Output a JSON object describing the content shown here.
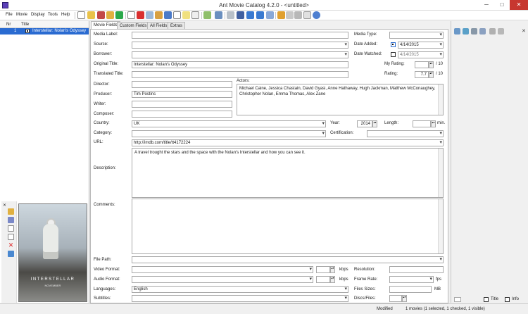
{
  "window": {
    "title": "Ant Movie Catalog 4.2.0 - <untitled>"
  },
  "menu": [
    "File",
    "Movie",
    "Display",
    "Tools",
    "Help"
  ],
  "list": {
    "headers": [
      "Nr",
      "Title"
    ],
    "rows": [
      {
        "nr": "1",
        "title": "Interstellar: Nolan's Odyssey",
        "selected": true,
        "checked": true
      }
    ]
  },
  "poster": {
    "title": "INTERSTELLAR",
    "subtitle": "NOVEMBER"
  },
  "tabs": [
    "Movie Fields",
    "Custom Fields",
    "All Fields",
    "Extras"
  ],
  "fields": {
    "media_label": {
      "label": "Media Label:",
      "value": ""
    },
    "media_type": {
      "label": "Media Type:",
      "value": ""
    },
    "source": {
      "label": "Source:",
      "value": ""
    },
    "date_added": {
      "label": "Date Added:",
      "value": "4/14/2015",
      "checked": true
    },
    "borrower": {
      "label": "Borrower:",
      "value": ""
    },
    "date_watched": {
      "label": "Date Watched:",
      "value": "4/14/2015",
      "checked": false
    },
    "original_title": {
      "label": "Original Title:",
      "value": "Interstellar: Nolan's Odyssey"
    },
    "my_rating": {
      "label": "My Rating:",
      "value": "",
      "max": "/ 10"
    },
    "translated_title": {
      "label": "Translated Title:",
      "value": ""
    },
    "rating": {
      "label": "Rating:",
      "value": "7.7",
      "max": "/ 10"
    },
    "director": {
      "label": "Director:",
      "value": ""
    },
    "actors": {
      "label": "Actors:",
      "value": "Michael Caine, Jessica Chastain, David Gyasi, Anne Hathaway, Hugh Jackman, Matthew McConaughey, Christopher Nolan, Emma Thomas, Alex Zane"
    },
    "producer": {
      "label": "Producer:",
      "value": "Tim Postins"
    },
    "writer": {
      "label": "Writer:",
      "value": ""
    },
    "composer": {
      "label": "Composer:",
      "value": ""
    },
    "country": {
      "label": "Country:",
      "value": "UK"
    },
    "year": {
      "label": "Year:",
      "value": "2014"
    },
    "length": {
      "label": "Length:",
      "value": "",
      "unit": "min."
    },
    "category": {
      "label": "Category:",
      "value": ""
    },
    "certification": {
      "label": "Certification:",
      "value": ""
    },
    "url": {
      "label": "URL:",
      "value": "http://imdb.com/title/tt4172224"
    },
    "description": {
      "label": "Description:",
      "value": "A travel trought the stars and the space with the Nolan's Interstellar and how you can see it."
    },
    "comments": {
      "label": "Comments:",
      "value": ""
    },
    "file_path": {
      "label": "File Path:",
      "value": ""
    },
    "video_format": {
      "label": "Video Format:",
      "value": "",
      "unit": "kbps"
    },
    "resolution": {
      "label": "Resolution:",
      "value": ""
    },
    "audio_format": {
      "label": "Audio Format:",
      "value": "",
      "unit": "kbps"
    },
    "frame_rate": {
      "label": "Frame Rate:",
      "value": "",
      "unit": "fps"
    },
    "languages": {
      "label": "Languages:",
      "value": "English"
    },
    "files_sizes": {
      "label": "Files Sizes:",
      "value": "",
      "unit": "MB"
    },
    "subtitles": {
      "label": "Subtitles:",
      "value": ""
    },
    "discs_files": {
      "label": "Discs/Files:",
      "value": ""
    }
  },
  "right_panel": {
    "title_label": "Title",
    "info_label": "Info"
  },
  "status": {
    "state": "Modified",
    "summary": "1 movies (1 selected, 1 checked, 1 visible)"
  },
  "colors": {
    "selection": "#2a6bd1",
    "close_button": "#c7372f"
  }
}
